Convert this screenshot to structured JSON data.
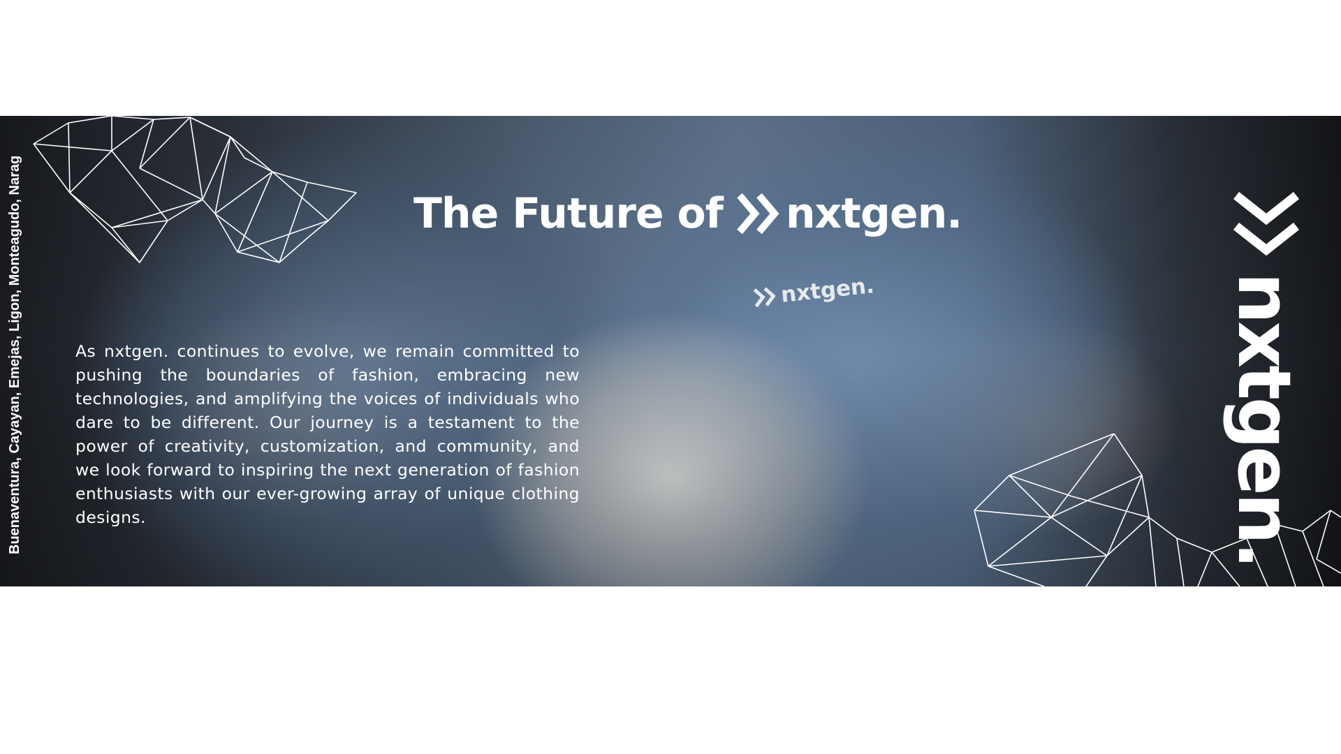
{
  "slide": {
    "locations": "Buenaventura, Cayayan, Emejas, Ligon, Monteagudo, Narag",
    "headline_prefix": "The Future of",
    "headline_brand": "nxtgen.",
    "body": "As nxtgen. continues to evolve, we remain committed to pushing the boundaries of fashion, embracing new technologies, and amplifying the voices of individuals who dare to be different. Our journey is a testament to the power of creativity, customization, and community, and we look forward to inspiring the next generation of fashion enthusiasts with our ever-growing array of unique clothing designs.",
    "pocket_logo": "nxtgen.",
    "side_wordmark": "nxtgen."
  },
  "icons": {
    "brand_mark": "double-chevron-right-icon",
    "side_mark": "double-chevron-down-icon",
    "decoration": "low-poly-mesh"
  },
  "colors": {
    "text": "#ffffff",
    "background": "#ffffff",
    "denim": "#6f86a3"
  }
}
